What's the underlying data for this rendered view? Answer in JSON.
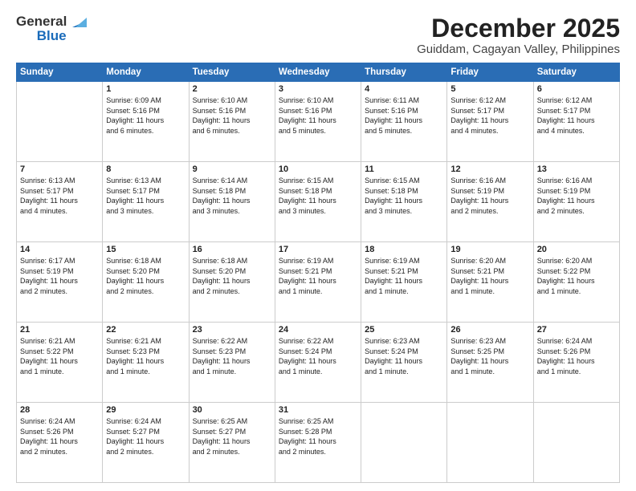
{
  "header": {
    "logo_line1": "General",
    "logo_line2": "Blue",
    "month": "December 2025",
    "location": "Guiddam, Cagayan Valley, Philippines"
  },
  "weekdays": [
    "Sunday",
    "Monday",
    "Tuesday",
    "Wednesday",
    "Thursday",
    "Friday",
    "Saturday"
  ],
  "weeks": [
    [
      {
        "day": "",
        "info": ""
      },
      {
        "day": "1",
        "info": "Sunrise: 6:09 AM\nSunset: 5:16 PM\nDaylight: 11 hours\nand 6 minutes."
      },
      {
        "day": "2",
        "info": "Sunrise: 6:10 AM\nSunset: 5:16 PM\nDaylight: 11 hours\nand 6 minutes."
      },
      {
        "day": "3",
        "info": "Sunrise: 6:10 AM\nSunset: 5:16 PM\nDaylight: 11 hours\nand 5 minutes."
      },
      {
        "day": "4",
        "info": "Sunrise: 6:11 AM\nSunset: 5:16 PM\nDaylight: 11 hours\nand 5 minutes."
      },
      {
        "day": "5",
        "info": "Sunrise: 6:12 AM\nSunset: 5:17 PM\nDaylight: 11 hours\nand 4 minutes."
      },
      {
        "day": "6",
        "info": "Sunrise: 6:12 AM\nSunset: 5:17 PM\nDaylight: 11 hours\nand 4 minutes."
      }
    ],
    [
      {
        "day": "7",
        "info": "Sunrise: 6:13 AM\nSunset: 5:17 PM\nDaylight: 11 hours\nand 4 minutes."
      },
      {
        "day": "8",
        "info": "Sunrise: 6:13 AM\nSunset: 5:17 PM\nDaylight: 11 hours\nand 3 minutes."
      },
      {
        "day": "9",
        "info": "Sunrise: 6:14 AM\nSunset: 5:18 PM\nDaylight: 11 hours\nand 3 minutes."
      },
      {
        "day": "10",
        "info": "Sunrise: 6:15 AM\nSunset: 5:18 PM\nDaylight: 11 hours\nand 3 minutes."
      },
      {
        "day": "11",
        "info": "Sunrise: 6:15 AM\nSunset: 5:18 PM\nDaylight: 11 hours\nand 3 minutes."
      },
      {
        "day": "12",
        "info": "Sunrise: 6:16 AM\nSunset: 5:19 PM\nDaylight: 11 hours\nand 2 minutes."
      },
      {
        "day": "13",
        "info": "Sunrise: 6:16 AM\nSunset: 5:19 PM\nDaylight: 11 hours\nand 2 minutes."
      }
    ],
    [
      {
        "day": "14",
        "info": "Sunrise: 6:17 AM\nSunset: 5:19 PM\nDaylight: 11 hours\nand 2 minutes."
      },
      {
        "day": "15",
        "info": "Sunrise: 6:18 AM\nSunset: 5:20 PM\nDaylight: 11 hours\nand 2 minutes."
      },
      {
        "day": "16",
        "info": "Sunrise: 6:18 AM\nSunset: 5:20 PM\nDaylight: 11 hours\nand 2 minutes."
      },
      {
        "day": "17",
        "info": "Sunrise: 6:19 AM\nSunset: 5:21 PM\nDaylight: 11 hours\nand 1 minute."
      },
      {
        "day": "18",
        "info": "Sunrise: 6:19 AM\nSunset: 5:21 PM\nDaylight: 11 hours\nand 1 minute."
      },
      {
        "day": "19",
        "info": "Sunrise: 6:20 AM\nSunset: 5:21 PM\nDaylight: 11 hours\nand 1 minute."
      },
      {
        "day": "20",
        "info": "Sunrise: 6:20 AM\nSunset: 5:22 PM\nDaylight: 11 hours\nand 1 minute."
      }
    ],
    [
      {
        "day": "21",
        "info": "Sunrise: 6:21 AM\nSunset: 5:22 PM\nDaylight: 11 hours\nand 1 minute."
      },
      {
        "day": "22",
        "info": "Sunrise: 6:21 AM\nSunset: 5:23 PM\nDaylight: 11 hours\nand 1 minute."
      },
      {
        "day": "23",
        "info": "Sunrise: 6:22 AM\nSunset: 5:23 PM\nDaylight: 11 hours\nand 1 minute."
      },
      {
        "day": "24",
        "info": "Sunrise: 6:22 AM\nSunset: 5:24 PM\nDaylight: 11 hours\nand 1 minute."
      },
      {
        "day": "25",
        "info": "Sunrise: 6:23 AM\nSunset: 5:24 PM\nDaylight: 11 hours\nand 1 minute."
      },
      {
        "day": "26",
        "info": "Sunrise: 6:23 AM\nSunset: 5:25 PM\nDaylight: 11 hours\nand 1 minute."
      },
      {
        "day": "27",
        "info": "Sunrise: 6:24 AM\nSunset: 5:26 PM\nDaylight: 11 hours\nand 1 minute."
      }
    ],
    [
      {
        "day": "28",
        "info": "Sunrise: 6:24 AM\nSunset: 5:26 PM\nDaylight: 11 hours\nand 2 minutes."
      },
      {
        "day": "29",
        "info": "Sunrise: 6:24 AM\nSunset: 5:27 PM\nDaylight: 11 hours\nand 2 minutes."
      },
      {
        "day": "30",
        "info": "Sunrise: 6:25 AM\nSunset: 5:27 PM\nDaylight: 11 hours\nand 2 minutes."
      },
      {
        "day": "31",
        "info": "Sunrise: 6:25 AM\nSunset: 5:28 PM\nDaylight: 11 hours\nand 2 minutes."
      },
      {
        "day": "",
        "info": ""
      },
      {
        "day": "",
        "info": ""
      },
      {
        "day": "",
        "info": ""
      }
    ]
  ]
}
